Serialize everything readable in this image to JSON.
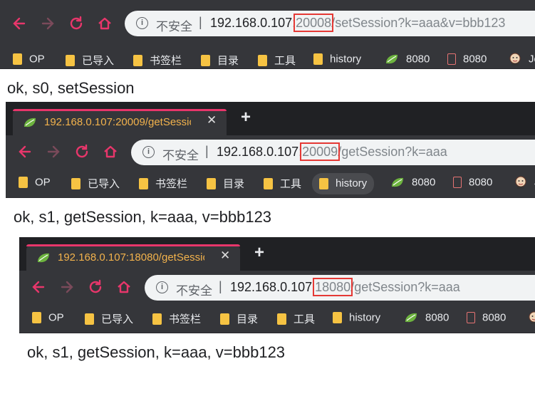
{
  "window1": {
    "url": {
      "host": "192.168.0.107",
      "colon": ":",
      "highlight": "20008",
      "rest": "/setSession?k=aaa&v=bbb123"
    },
    "content_text": "ok, s0, setSession"
  },
  "window2": {
    "tab_title": "192.168.0.107:20009/getSessio",
    "url": {
      "host": "192.168.0.107",
      "colon": ":",
      "highlight": "20009",
      "rest": "/getSession?k=aaa"
    },
    "content_text": "ok, s1, getSession, k=aaa, v=bbb123"
  },
  "window3": {
    "tab_title": "192.168.0.107:18080/getSessio",
    "url": {
      "host": "192.168.0.107",
      "colon": ":",
      "highlight": "18080",
      "rest": "/getSession?k=aaa"
    },
    "content_text": "ok, s1, getSession, k=aaa, v=bbb123"
  },
  "common": {
    "insecure_label": "不安全",
    "separator": "|",
    "info_icon_glyph": "i",
    "close_glyph": "✕",
    "newtab_glyph": "+",
    "bookmarks": [
      {
        "label": "OP",
        "icon": "folder-icon"
      },
      {
        "label": "已导入",
        "icon": "folder-icon"
      },
      {
        "label": "书签栏",
        "icon": "folder-icon"
      },
      {
        "label": "目录",
        "icon": "folder-icon"
      },
      {
        "label": "工具",
        "icon": "folder-icon"
      },
      {
        "label": "history",
        "icon": "folder-icon"
      },
      {
        "label": "8080",
        "icon": "spring-leaf-icon"
      },
      {
        "label": "8080",
        "icon": "document-icon"
      },
      {
        "label": "Je",
        "icon": "jenkins-icon"
      }
    ]
  },
  "colors": {
    "chrome_dark": "#35363a",
    "tab_bar": "#202124",
    "tab_accent": "#e8366b",
    "tab_title": "#f2b24c",
    "highlight_box": "#e53935",
    "nav_icon": "#e8366b",
    "folder": "#f6c343",
    "spring_green": "#6db33f"
  }
}
